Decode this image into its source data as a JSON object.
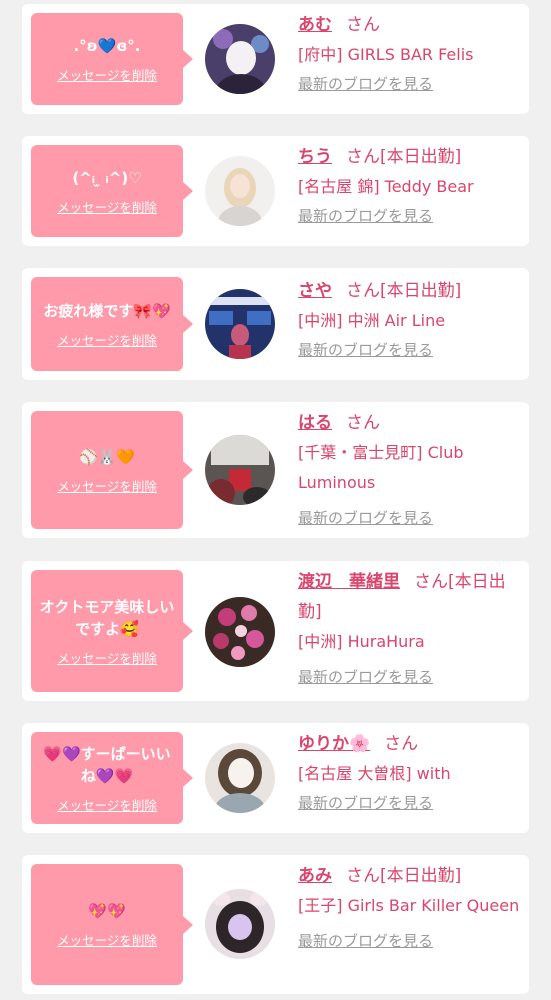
{
  "colors": {
    "accent": "#ff9aaa",
    "text_pink": "#d9466d",
    "link_gray": "#9a9a9a",
    "background": "#f0f0f0"
  },
  "delete_label": "メッセージを削除",
  "blog_label": "最新のブログを見る",
  "messages": [
    {
      "message": ".°ʚ💙ɞ°.",
      "name": "あむ",
      "suffix": "さん",
      "shop": "[府中] GIRLS BAR Felis",
      "avatar": "avatar-photo"
    },
    {
      "message": "(^ᵢ ̫ ᵢ^)♡",
      "name": "ちう",
      "suffix": "さん[本日出勤]",
      "shop": "[名古屋 錦] Teddy Bear",
      "avatar": "avatar-photo"
    },
    {
      "message": "お疲れ様です🎀💖",
      "name": "さや",
      "suffix": "さん[本日出勤]",
      "shop": "[中洲] 中洲 Air Line",
      "avatar": "avatar-photo"
    },
    {
      "message": "⚾🐰🧡",
      "name": "はる",
      "suffix": "さん",
      "shop": "[千葉・富士見町] Club Luminous",
      "avatar": "avatar-photo"
    },
    {
      "message": "オクトモア美味しいですよ🥰",
      "name": "渡辺　華緒里",
      "suffix": "さん[本日出勤]",
      "shop": "[中洲] HuraHura",
      "avatar": "avatar-photo"
    },
    {
      "message": "💗💜すーぱーいいね💜💗",
      "name": "ゆりか🌸",
      "suffix": "さん",
      "shop": "[名古屋 大曽根] with",
      "avatar": "avatar-photo"
    },
    {
      "message": "💖💖",
      "name": "あみ",
      "suffix": "さん[本日出勤]",
      "shop": "[王子] Girls Bar Killer Queen",
      "avatar": "avatar-photo"
    }
  ]
}
